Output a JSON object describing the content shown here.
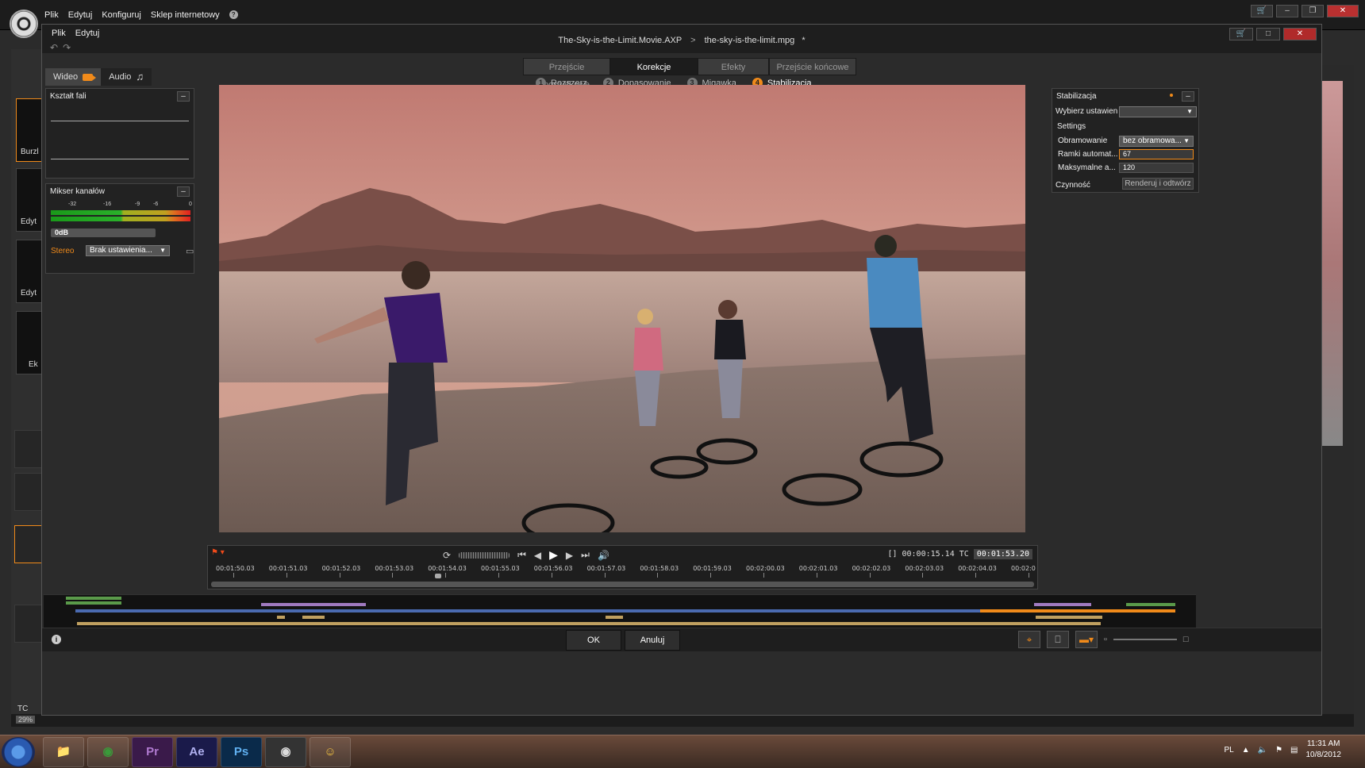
{
  "outer": {
    "menu": [
      "Plik",
      "Edytuj",
      "Konfiguruj",
      "Sklep internetowy"
    ],
    "left_labels": [
      "Burzl",
      "Edyt",
      "Edyt",
      "Ek"
    ],
    "tc_label": "TC",
    "zoom_pct": "29%"
  },
  "dialog": {
    "menu": [
      "Plik",
      "Edytuj"
    ],
    "project": "The-Sky-is-the-Limit.Movie.AXP",
    "arrow": ">",
    "clip": "the-sky-is-the-limit.mpg",
    "modified_mark": "*"
  },
  "tabs": [
    {
      "label": "Przejście początkowe",
      "active": false
    },
    {
      "label": "Korekcje",
      "active": true
    },
    {
      "label": "Efekty",
      "active": false
    },
    {
      "label": "Przejście końcowe",
      "active": false
    }
  ],
  "subtabs": [
    {
      "num": "1",
      "label": "Rozszerz",
      "active": false
    },
    {
      "num": "2",
      "label": "Dopasowanie",
      "active": false
    },
    {
      "num": "3",
      "label": "Migawka",
      "active": false
    },
    {
      "num": "4",
      "label": "Stabilizacja",
      "active": true
    }
  ],
  "media_tabs": {
    "video": "Wideo",
    "audio": "Audio"
  },
  "waveform_panel": {
    "title": "Kształt fali"
  },
  "mixer_panel": {
    "title": "Mikser kanałów",
    "scale": [
      "-32",
      "-16",
      "-9",
      "-6",
      "0"
    ],
    "gain_label": "0dB",
    "stereo_label": "Stereo",
    "preset_select": "Brak ustawienia..."
  },
  "stab_panel": {
    "title": "Stabilizacja",
    "choose_label": "Wybierz ustawien",
    "choose_value": "",
    "settings_label": "Settings",
    "border_label": "Obramowanie",
    "border_value": "bez obramowa...",
    "auto_label": "Ramki automat...",
    "auto_value": "67",
    "max_label": "Maksymalne a...",
    "max_value": "120",
    "action_label": "Czynność",
    "render_button": "Renderuj i odtwórz"
  },
  "transport": {
    "tc_prefix": "[]",
    "duration": "00:00:15.14",
    "tc_label": "TC",
    "current_tc": "00:01:53.20",
    "ruler_labels": [
      "00:01:50.03",
      "00:01:51.03",
      "00:01:52.03",
      "00:01:53.03",
      "00:01:54.03",
      "00:01:55.03",
      "00:01:56.03",
      "00:01:57.03",
      "00:01:58.03",
      "00:01:59.03",
      "00:02:00.03",
      "00:02:01.03",
      "00:02:02.03",
      "00:02:03.03",
      "00:02:04.03",
      "00:02:0"
    ]
  },
  "buttons": {
    "ok": "OK",
    "cancel": "Anuluj"
  },
  "taskbar": {
    "apps": [
      "Pr",
      "Ae",
      "Ps"
    ],
    "lang": "PL",
    "time": "11:31 AM",
    "date": "10/8/2012"
  },
  "colors": {
    "accent": "#f08a1a",
    "close": "#b02a2a"
  }
}
